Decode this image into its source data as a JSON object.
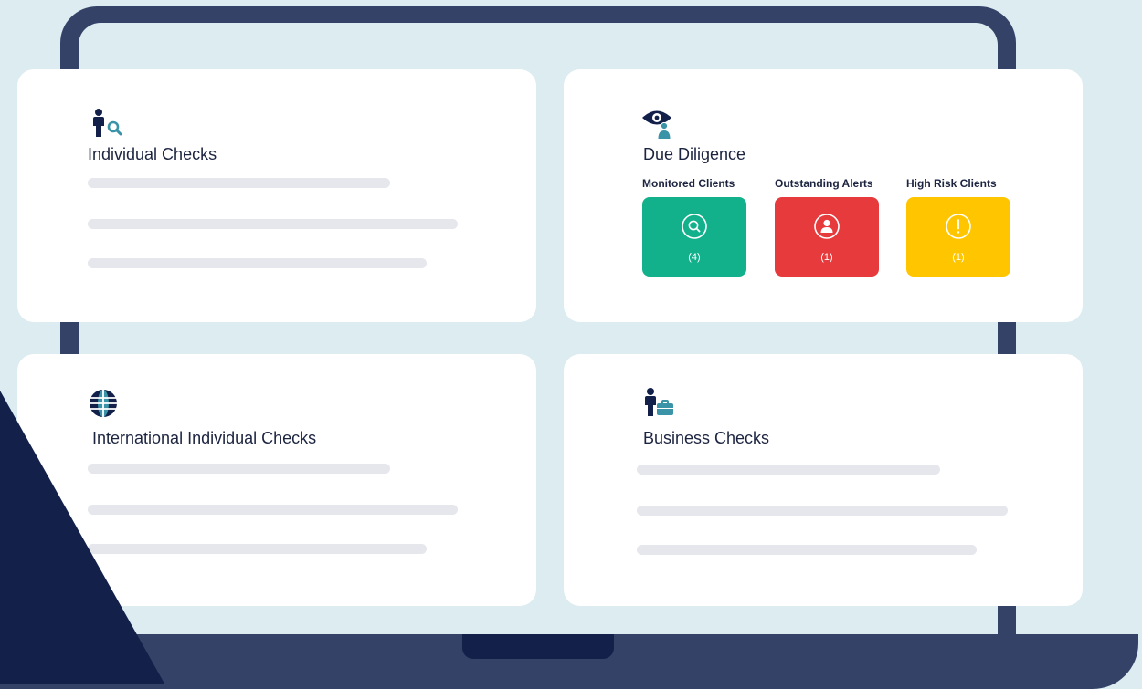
{
  "colors": {
    "background": "#dcecf1",
    "laptop": "#354267",
    "navy": "#12204a",
    "card": "#ffffff",
    "skeleton": "#e6e7ec",
    "green": "#13b08c",
    "red": "#e63a3c",
    "yellow": "#ffc600",
    "teal_accent": "#3a93a6"
  },
  "cards": {
    "individual": {
      "title": "Individual Checks",
      "icon": "person-search-icon"
    },
    "due_diligence": {
      "title": "Due Diligence",
      "icon": "eye-person-icon",
      "tiles": [
        {
          "label": "Monitored Clients",
          "count": "(4)",
          "icon": "search-icon",
          "color": "#13b08c"
        },
        {
          "label": "Outstanding Alerts",
          "count": "(1)",
          "icon": "user-icon",
          "color": "#e63a3c"
        },
        {
          "label": "High Risk Clients",
          "count": "(1)",
          "icon": "exclamation-icon",
          "color": "#ffc600"
        }
      ]
    },
    "international": {
      "title": "International Individual Checks",
      "icon": "globe-icon"
    },
    "business": {
      "title": "Business Checks",
      "icon": "person-briefcase-icon"
    }
  }
}
